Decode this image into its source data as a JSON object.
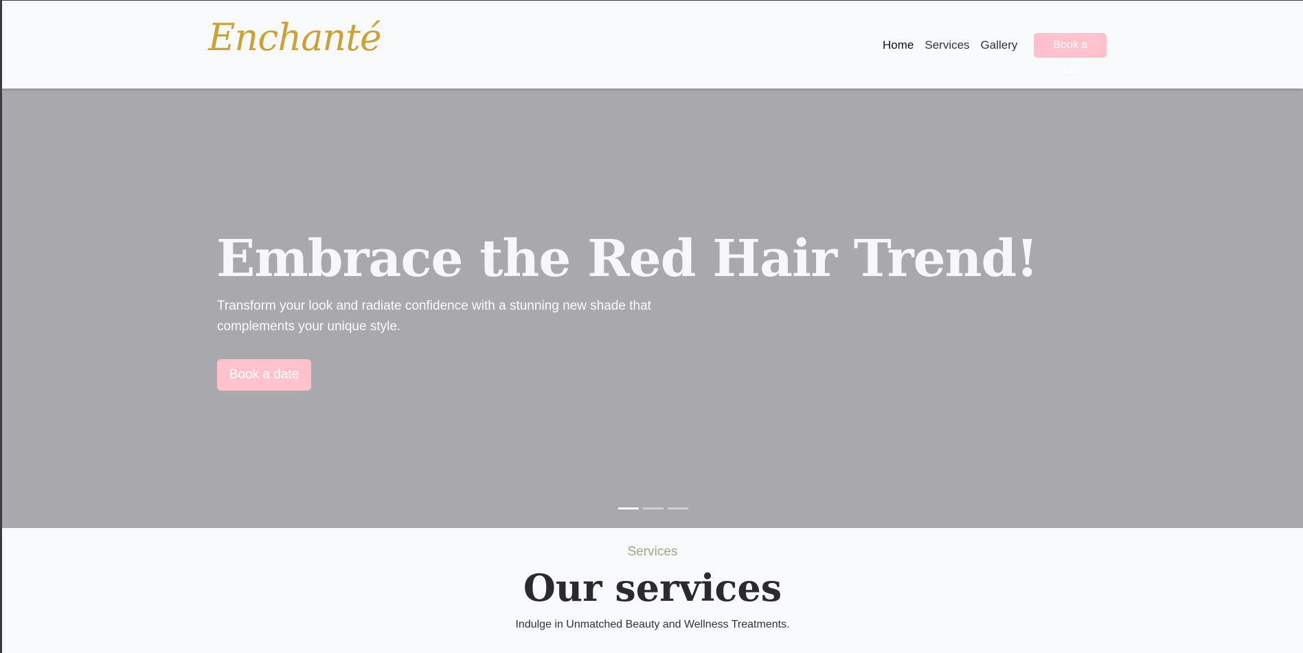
{
  "header": {
    "brand": "Enchanté",
    "nav": [
      {
        "label": "Home"
      },
      {
        "label": "Services"
      },
      {
        "label": "Gallery"
      }
    ],
    "cta_label": "Book a date"
  },
  "hero": {
    "title": "Embrace the Red Hair Trend!",
    "subtitle": "Transform your look and radiate confidence with a stunning new shade that complements your unique style.",
    "cta_label": "Book a date",
    "slides_total": 3,
    "active_slide": 1
  },
  "services": {
    "eyebrow": "Services",
    "title": "Our services",
    "description": "Indulge in Unmatched Beauty and Wellness Treatments."
  },
  "colors": {
    "brand_gold": "#c9a33a",
    "accent_pink": "#ffc2cd",
    "hero_bg": "#a9a8ad",
    "page_bg": "#f8f9fb",
    "eyebrow_green": "#9aaa8c"
  }
}
